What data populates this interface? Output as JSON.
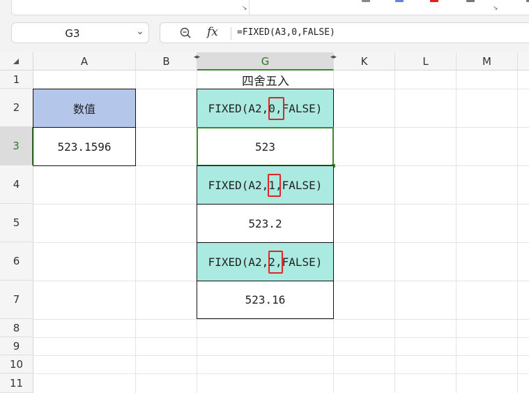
{
  "formula_bar": {
    "name_box": "G3",
    "fx_label": "fx",
    "formula": "=FIXED(A3,0,FALSE)"
  },
  "columns": [
    "A",
    "B",
    "G",
    "K",
    "L",
    "M"
  ],
  "rows": [
    "1",
    "2",
    "3",
    "4",
    "5",
    "6",
    "7",
    "8",
    "9",
    "10",
    "11"
  ],
  "cells": {
    "A2": "数值",
    "A3": "523.1596",
    "G1": "四舍五入",
    "G2": "FIXED(A2,0,FALSE)",
    "G3": "523",
    "G4": "FIXED(A2,1,FALSE)",
    "G5": "523.2",
    "G6": "FIXED(A2,2,FALSE)",
    "G7": "523.16"
  },
  "colors": {
    "header_fill": "#b4c6ea",
    "formula_fill": "#aaeae0",
    "selection": "#3a8a2a",
    "highlight": "#e12424"
  }
}
